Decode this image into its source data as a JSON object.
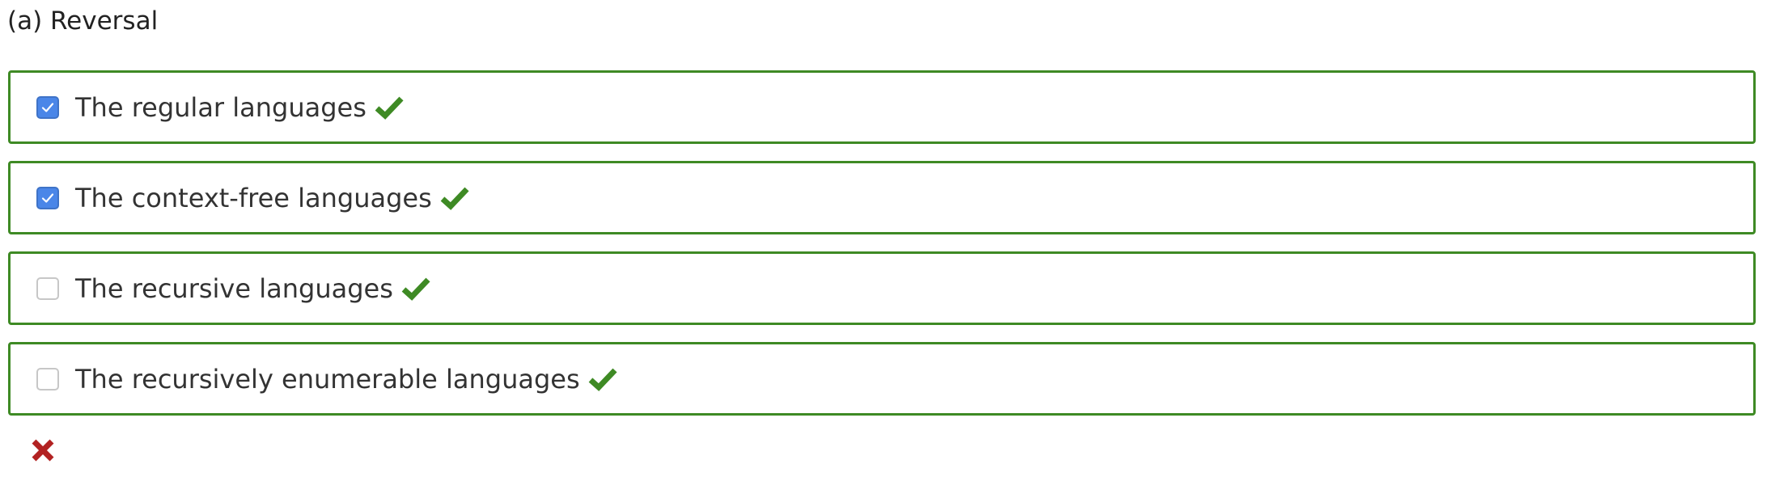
{
  "question": {
    "title": "(a) Reversal"
  },
  "options": [
    {
      "label": "The regular languages",
      "checked": true,
      "feedback_icon": "green-check-icon"
    },
    {
      "label": "The context-free languages",
      "checked": true,
      "feedback_icon": "green-check-icon"
    },
    {
      "label": "The recursive languages",
      "checked": false,
      "feedback_icon": "green-check-icon"
    },
    {
      "label": "The recursively enumerable languages",
      "checked": false,
      "feedback_icon": "green-check-icon"
    }
  ],
  "result": {
    "icon": "red-x-icon"
  },
  "colors": {
    "option_border": "#3e8a24",
    "check_mark": "#3e8a24",
    "checkbox_checked": "#4a86e8",
    "wrong_mark": "#b22222"
  }
}
